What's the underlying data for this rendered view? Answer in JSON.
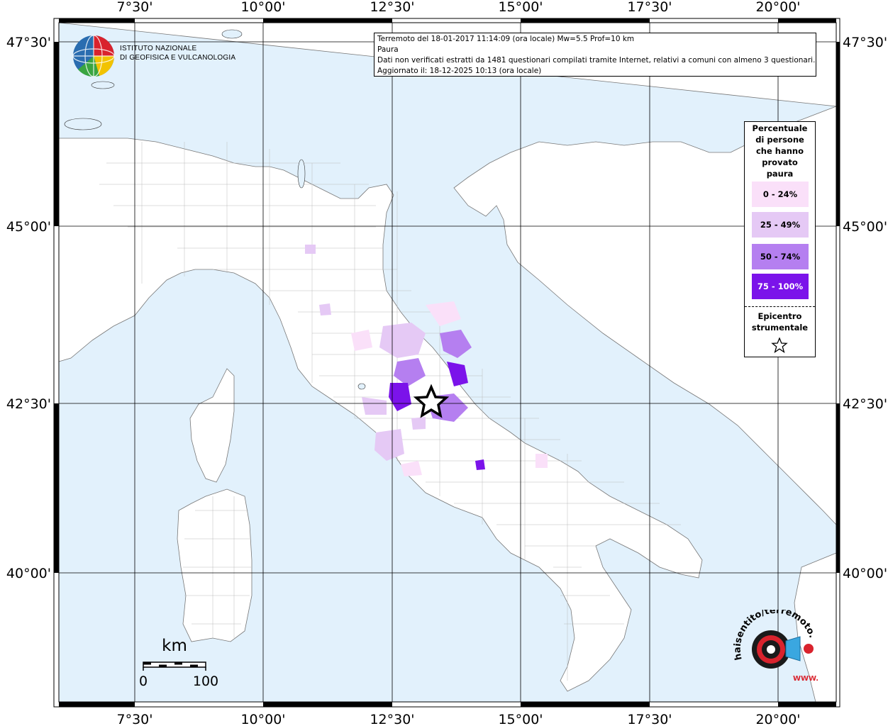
{
  "map": {
    "top_labels": [
      "7°30'",
      "10°00'",
      "12°30'",
      "15°00'",
      "17°30'",
      "20°00'"
    ],
    "bottom_labels": [
      "7°30'",
      "10°00'",
      "12°30'",
      "15°00'",
      "17°30'",
      "20°00'"
    ],
    "left_labels": [
      "47°30'",
      "45°00'",
      "42°30'",
      "40°00'"
    ],
    "right_labels": [
      "47°30'",
      "45°00'",
      "42°30'",
      "40°00'"
    ],
    "colors": {
      "sea": "#e2f1fc",
      "land": "#ffffff",
      "border": "#000000",
      "grid": "#000000"
    }
  },
  "info": {
    "line1": "Terremoto del 18-01-2017 11:14:09 (ora locale) Mw=5.5 Prof=10 km",
    "line2": "Paura",
    "line3": "Dati non verificati estratti da 1481 questionari compilati tramite Internet, relativi a comuni con almeno 3 questionari.",
    "line4": "Aggiornato il: 18-12-2025 10:13 (ora locale)"
  },
  "ingv": {
    "text": "ISTITUTO NAZIONALE\nDI GEOFISICA E VULCANOLOGIA"
  },
  "legend": {
    "title": "Percentuale\ndi persone\nche hanno\nprovato\npaura",
    "items": [
      {
        "label": "0 - 24%",
        "color": "#fae0f9",
        "text_color": "#000000"
      },
      {
        "label": "25 - 49%",
        "color": "#e5c9f5",
        "text_color": "#000000"
      },
      {
        "label": "50 - 74%",
        "color": "#b57ff0",
        "text_color": "#000000"
      },
      {
        "label": "75 - 100%",
        "color": "#7b13ea",
        "text_color": "#ffffff"
      }
    ],
    "epicenter_label": "Epicentro\nstrumentale"
  },
  "scalebar": {
    "unit": "km",
    "start": "0",
    "end": "100"
  },
  "hst_logo": {
    "text": "haisentito/terremoto.it",
    "url": "WWW."
  }
}
